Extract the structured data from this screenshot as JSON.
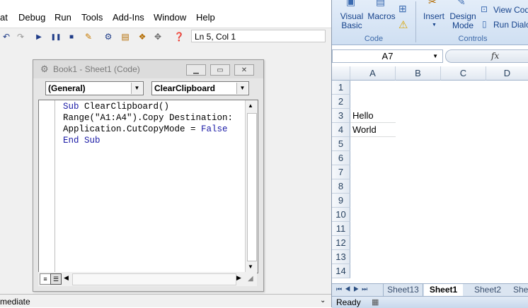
{
  "vbe": {
    "menus": [
      {
        "label": "at"
      },
      {
        "label": "Debug"
      },
      {
        "label": "Run"
      },
      {
        "label": "Tools"
      },
      {
        "label": "Add-Ins"
      },
      {
        "label": "Window"
      },
      {
        "label": "Help"
      }
    ],
    "status_position": "Ln 5, Col 1",
    "code_window": {
      "title": "Book1 - Sheet1 (Code)",
      "object_combo": "(General)",
      "procedure_combo": "ClearClipboard",
      "lines": [
        "Sub ClearClipboard()",
        "Range(\"A1:A4\").Copy Destination:",
        "Application.CutCopyMode = ",
        "End Sub"
      ],
      "keyword_false": "False"
    },
    "immediate_label": "mediate"
  },
  "excel": {
    "ribbon": {
      "visual_basic": [
        "Visual",
        "Basic"
      ],
      "macros": "Macros",
      "code_group": "Code",
      "insert": "Insert",
      "design_mode": [
        "Design",
        "Mode"
      ],
      "view_code": "View Cod",
      "run_dialog": "Run Dialo",
      "controls_group": "Controls"
    },
    "name_box": "A7",
    "fx_label": "fx",
    "columns": [
      "A",
      "B",
      "C",
      "D"
    ],
    "rows": [
      "1",
      "2",
      "3",
      "4",
      "5",
      "6",
      "7",
      "8",
      "9",
      "10",
      "11",
      "12",
      "13",
      "14"
    ],
    "cells": {
      "A3": "Hello",
      "A4": "World"
    },
    "sheet_tabs": [
      "Sheet13",
      "Sheet1",
      "Sheet2",
      "She"
    ],
    "active_tab": "Sheet1",
    "status": "Ready"
  }
}
